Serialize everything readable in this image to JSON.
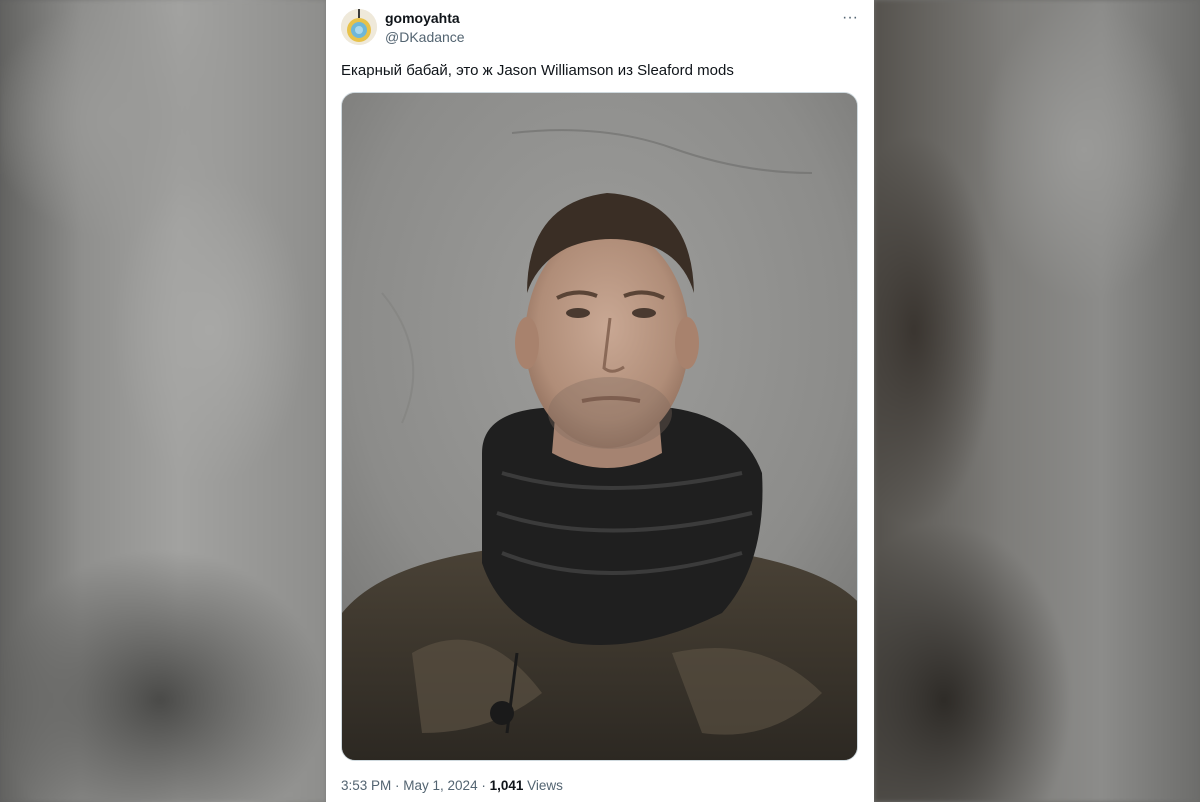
{
  "tweet": {
    "author": {
      "display_name": "gomoyahta",
      "handle": "@DKadance",
      "avatar_icon": "avatar-icon"
    },
    "more_icon": "more-options-icon",
    "more_glyph": "···",
    "text": "Екарный бабай, это ж Jason Williamson из Sleaford mods",
    "media": {
      "type": "photo"
    },
    "meta": {
      "time": "3:53 PM",
      "separator": " · ",
      "date": "May 1, 2024",
      "views_count": "1,041",
      "views_label": "Views"
    }
  },
  "colors": {
    "text_primary": "#0f1419",
    "text_secondary": "#536471",
    "card_background": "#ffffff",
    "media_border": "#cfd9de"
  }
}
